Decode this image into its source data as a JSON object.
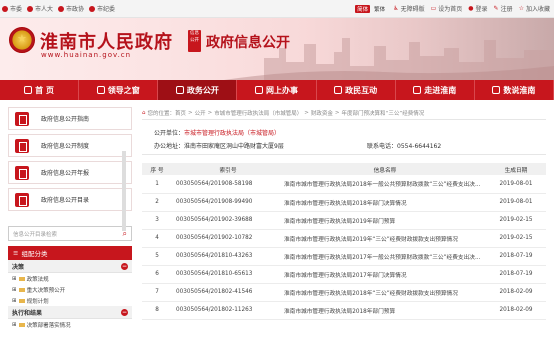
{
  "topbar": {
    "left_links": [
      "市委",
      "市人大",
      "市政协",
      "市纪委"
    ],
    "lang_simplified": "简体",
    "lang_traditional": "繁体",
    "accessibility": "无障碍版",
    "favorite_label": "设为首页",
    "login": "登录",
    "register": "注册",
    "bookmark": "加入收藏"
  },
  "banner": {
    "site_title": "淮南市人民政府",
    "site_url": "www.huainan.gov.cn",
    "seal_text": "信息公开",
    "section_title": "政府信息公开"
  },
  "nav": {
    "items": [
      {
        "label": "首 页"
      },
      {
        "label": "领导之窗"
      },
      {
        "label": "政务公开"
      },
      {
        "label": "网上办事"
      },
      {
        "label": "政民互动"
      },
      {
        "label": "走进淮南"
      },
      {
        "label": "数说淮南"
      }
    ]
  },
  "sidebar": {
    "buttons": [
      {
        "label": "政府信息公开指南"
      },
      {
        "label": "政府信息公开制度"
      },
      {
        "label": "政府信息公开年报"
      },
      {
        "label": "政府信息公开目录"
      }
    ],
    "search_placeholder": "信息公开目录检索",
    "category_header": "组配分类",
    "group1": "决策",
    "tree": [
      "政策法规",
      "重大决策预公开",
      "规划计划"
    ],
    "group2": "执行和结果",
    "tree2": [
      "决策部署落实情况"
    ]
  },
  "main": {
    "breadcrumb": [
      "您的位置：首页",
      "公开",
      "市城市管理行政执法局（市城管局）",
      "财政资金",
      "年度部门预决算和“三公”经费情况"
    ],
    "publisher_label": "公开单位：",
    "publisher": "市城市管理行政执法局（市城管局）",
    "address_label": "办公地址：",
    "address": "淮南市田家庵区洞山中路财富大厦9层",
    "phone_label": "联系电话：",
    "phone": "0554-6644162",
    "table": {
      "headers": [
        "序 号",
        "索引号",
        "信息名称",
        "生成日期"
      ],
      "rows": [
        [
          "1",
          "003050564/201908-58198",
          "淮南市城市管理行政执法局2018年一般公共预算财政拨款“三公”经费支出决...",
          "2019-08-01"
        ],
        [
          "2",
          "003050564/201908-99490",
          "淮南市城市管理行政执法局2018年部门决算情况",
          "2019-08-01"
        ],
        [
          "3",
          "003050564/201902-39688",
          "淮南市城市管理行政执法局2019年部门预算",
          "2019-02-15"
        ],
        [
          "4",
          "003050564/201902-10782",
          "淮南市城市管理行政执法局2019年“三公”经费财政拨款支出预算情况",
          "2019-02-15"
        ],
        [
          "5",
          "003050564/201810-43263",
          "淮南市城市管理行政执法局2017年一般公共预算财政拨款“三公”经费支出决...",
          "2018-07-19"
        ],
        [
          "6",
          "003050564/201810-65613",
          "淮南市城市管理行政执法局2017年部门决算情况",
          "2018-07-19"
        ],
        [
          "7",
          "003050564/201802-41546",
          "淮南市城市管理行政执法局2018年“三公”经费财政拨款支出预算情况",
          "2018-02-09"
        ],
        [
          "8",
          "003050564/201802-11263",
          "淮南市城市管理行政执法局2018年部门预算",
          "2018-02-09"
        ]
      ]
    }
  },
  "colors": {
    "brand_red": "#c7161d",
    "dark_red": "#9e0f15"
  }
}
